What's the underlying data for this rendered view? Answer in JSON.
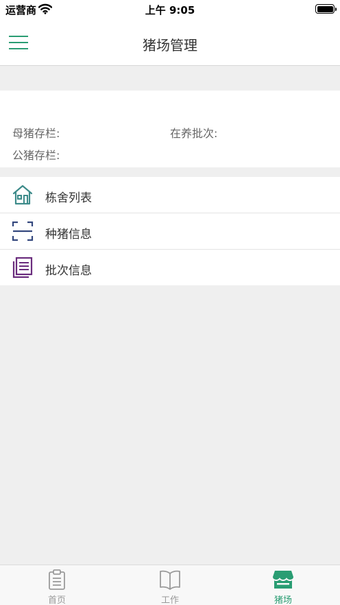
{
  "status_bar": {
    "carrier": "运营商",
    "time": "上午 9:05"
  },
  "nav": {
    "title": "猪场管理"
  },
  "stats": {
    "sow_label": "母猪存栏:",
    "batch_label": "在养批次:",
    "boar_label": "公猪存栏:"
  },
  "menu": {
    "items": [
      {
        "label": "栋舍列表",
        "icon": "house-icon",
        "color": "#3d8b8a"
      },
      {
        "label": "种猪信息",
        "icon": "scan-frame-icon",
        "color": "#34487e"
      },
      {
        "label": "批次信息",
        "icon": "document-stack-icon",
        "color": "#6a2c7d"
      }
    ]
  },
  "tab_bar": {
    "tabs": [
      {
        "label": "首页",
        "icon": "clipboard-icon",
        "active": false
      },
      {
        "label": "工作",
        "icon": "book-icon",
        "active": false
      },
      {
        "label": "猪场",
        "icon": "store-icon",
        "active": true
      }
    ]
  },
  "colors": {
    "accent": "#2a9d73",
    "background": "#efefef"
  }
}
